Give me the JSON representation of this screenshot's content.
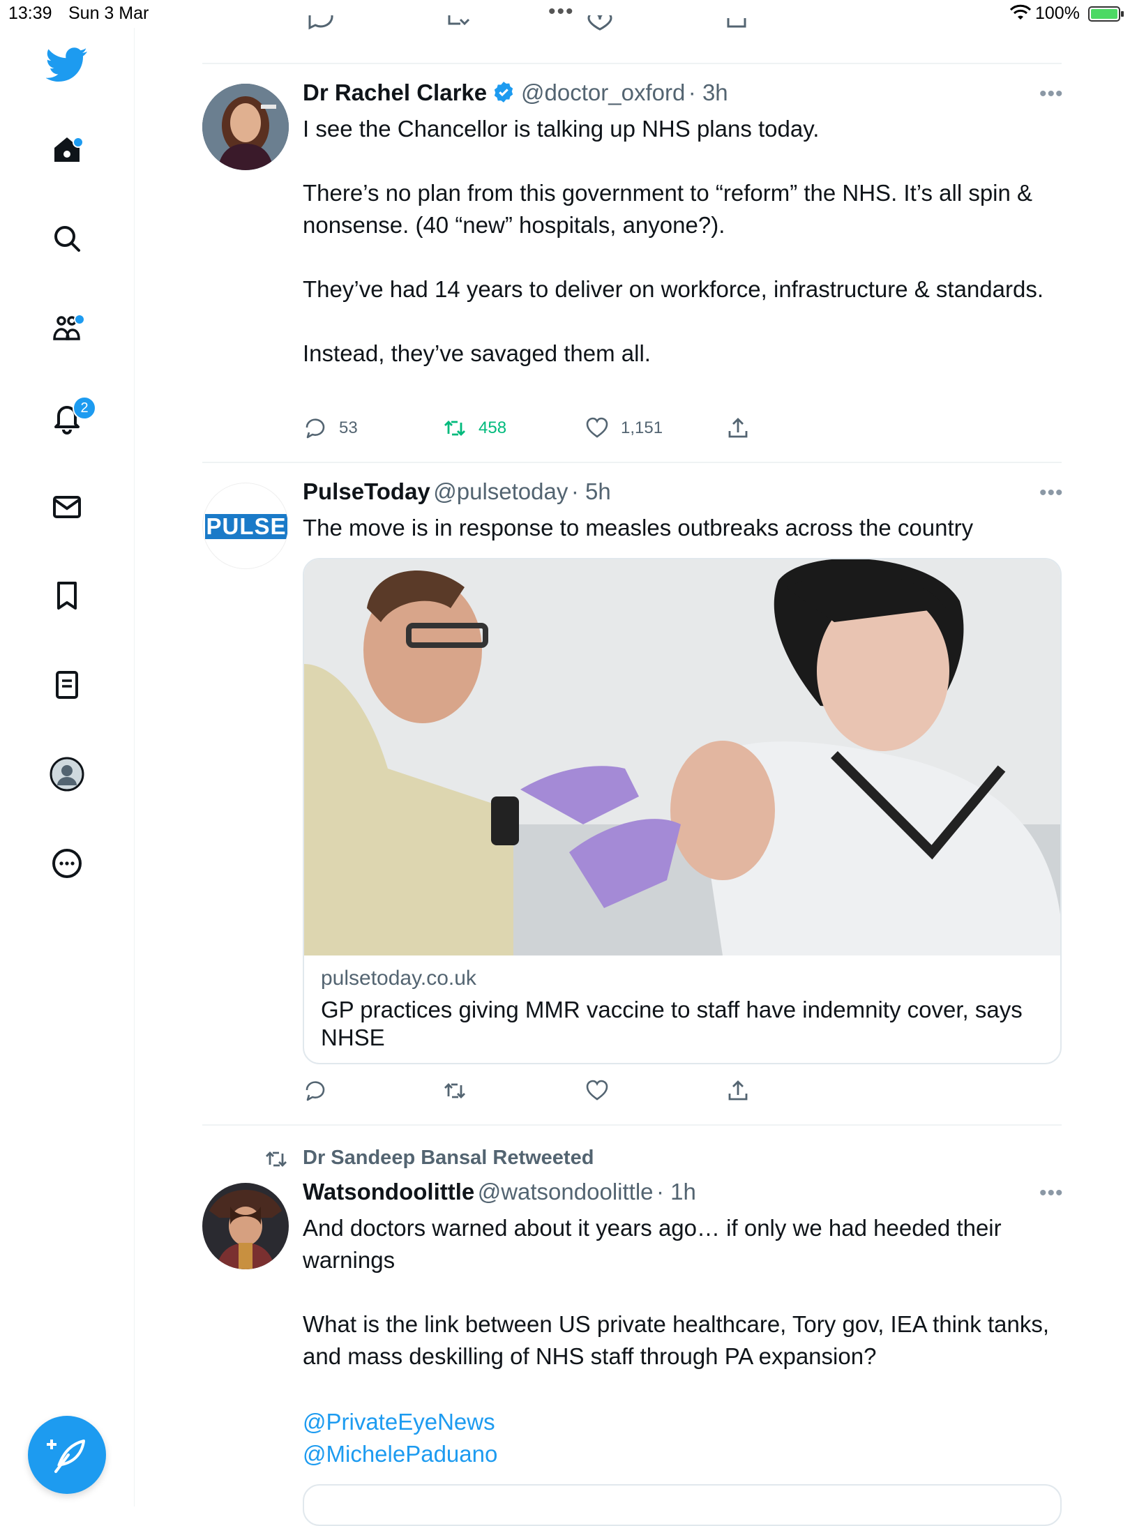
{
  "status_bar": {
    "time": "13:39",
    "date": "Sun 3 Mar",
    "dots": "•••",
    "battery": "100%"
  },
  "sidebar": {
    "notifications_count": "2"
  },
  "tweets": [
    {
      "name": "Dr Rachel Clarke",
      "handle": "@doctor_oxford",
      "time": "· 3h",
      "text": "I see the Chancellor is talking up NHS plans today.\n\nThere’s no plan from this government to “reform” the NHS. It’s all spin & nonsense. (40 “new” hospitals, anyone?).\n\nThey’ve had 14 years to deliver on workforce, infrastructure & standards.\n\nInstead, they’ve savaged them all.",
      "replies": "53",
      "retweets": "458",
      "likes": "1,151"
    },
    {
      "name": "PulseToday",
      "handle": "@pulsetoday",
      "time": "· 5h",
      "avatar_text": "PULSE",
      "text": "The move is in response to measles outbreaks across the country",
      "card": {
        "domain": "pulsetoday.co.uk",
        "title": "GP practices giving MMR vaccine to staff have indemnity cover, says NHSE"
      }
    },
    {
      "retweeted_by": "Dr Sandeep Bansal Retweeted",
      "name": "Watsondoolittle",
      "handle": "@watsondoolittle",
      "time": "· 1h",
      "text_1": "And doctors warned about it years ago… if only we had heeded their warnings\n\nWhat is the link between US private healthcare, Tory gov, IEA think tanks, and mass deskilling of NHS staff through PA expansion?",
      "mention_1": "@PrivateEyeNews",
      "mention_2": "@MichelePaduano"
    }
  ],
  "colors": {
    "accent": "#1d9bf0",
    "retweet_active": "#00ba7c",
    "secondary_text": "#536471"
  }
}
